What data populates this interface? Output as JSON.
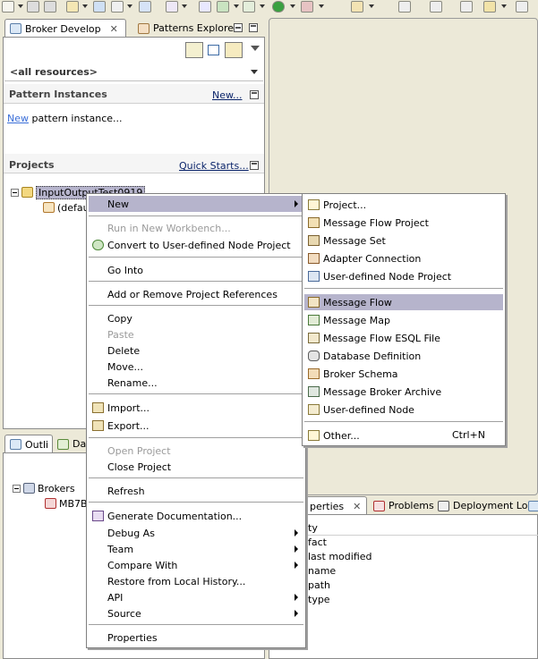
{
  "left_view": {
    "tabs": [
      {
        "label": "Broker Develop",
        "icon": "broker-development-icon"
      },
      {
        "label": "Patterns Explore",
        "icon": "patterns-icon"
      }
    ],
    "filter_value": "<all resources>",
    "pattern_instances": {
      "title": "Pattern Instances",
      "new_link": "New...",
      "new_link_short": "New",
      "new_text": " pattern instance..."
    },
    "projects": {
      "title": "Projects",
      "quick_starts_link": "Quick Starts...",
      "project_name": "InputOutputTest0919",
      "child_label": "(defau"
    }
  },
  "outline_view": {
    "tabs": [
      {
        "label": "Outli",
        "icon": "outline-icon"
      },
      {
        "label": "Da",
        "icon": "data-icon"
      }
    ],
    "brokers_label": "Brokers",
    "broker_child": "MB7B"
  },
  "properties_view": {
    "tabs": [
      {
        "label": "perties",
        "icon": "properties-icon"
      },
      {
        "label": "Problems",
        "icon": "problems-icon"
      },
      {
        "label": "Deployment Log",
        "icon": "deployment-log-icon"
      }
    ],
    "header": "ty",
    "rows": [
      "fact",
      "last modified",
      "name",
      "path",
      "type"
    ]
  },
  "context_menu": {
    "items": [
      {
        "label": "New",
        "submenu": true,
        "selected": true
      },
      {
        "label": "Run in New Workbench...",
        "disabled": true
      },
      {
        "label": "Convert to User-defined Node Project",
        "icon": "convert-icon"
      },
      {
        "label": "Go Into"
      },
      {
        "label": "Add or Remove Project References"
      },
      {
        "label": "Copy"
      },
      {
        "label": "Paste",
        "disabled": true
      },
      {
        "label": "Delete"
      },
      {
        "label": "Move..."
      },
      {
        "label": "Rename..."
      },
      {
        "label": "Import...",
        "icon": "import-icon"
      },
      {
        "label": "Export...",
        "icon": "export-icon"
      },
      {
        "label": "Open Project",
        "disabled": true
      },
      {
        "label": "Close Project"
      },
      {
        "label": "Refresh"
      },
      {
        "label": "Generate Documentation...",
        "icon": "documentation-icon"
      },
      {
        "label": "Debug As",
        "submenu": true
      },
      {
        "label": "Team",
        "submenu": true
      },
      {
        "label": "Compare With",
        "submenu": true
      },
      {
        "label": "Restore from Local History..."
      },
      {
        "label": "API",
        "submenu": true
      },
      {
        "label": "Source",
        "submenu": true
      },
      {
        "label": "Properties"
      }
    ]
  },
  "new_submenu": {
    "items": [
      {
        "label": "Project...",
        "icon": "project-icon"
      },
      {
        "label": "Message Flow Project",
        "icon": "message-flow-project-icon"
      },
      {
        "label": "Message Set",
        "icon": "message-set-icon"
      },
      {
        "label": "Adapter Connection",
        "icon": "adapter-connection-icon"
      },
      {
        "label": "User-defined Node Project",
        "icon": "udn-project-icon"
      },
      {
        "label": "Message Flow",
        "icon": "message-flow-icon",
        "selected": true
      },
      {
        "label": "Message Map",
        "icon": "message-map-icon"
      },
      {
        "label": "Message Flow ESQL File",
        "icon": "esql-file-icon"
      },
      {
        "label": "Database Definition",
        "icon": "database-icon"
      },
      {
        "label": "Broker Schema",
        "icon": "broker-schema-icon"
      },
      {
        "label": "Message Broker Archive",
        "icon": "bar-file-icon"
      },
      {
        "label": "User-defined Node",
        "icon": "udn-icon"
      },
      {
        "label": "Other...",
        "icon": "other-wizard-icon",
        "accelerator": "Ctrl+N"
      }
    ]
  },
  "colors": {
    "selection": "#b6b4cc",
    "background": "#ece9d8",
    "link": "#0a246a"
  }
}
